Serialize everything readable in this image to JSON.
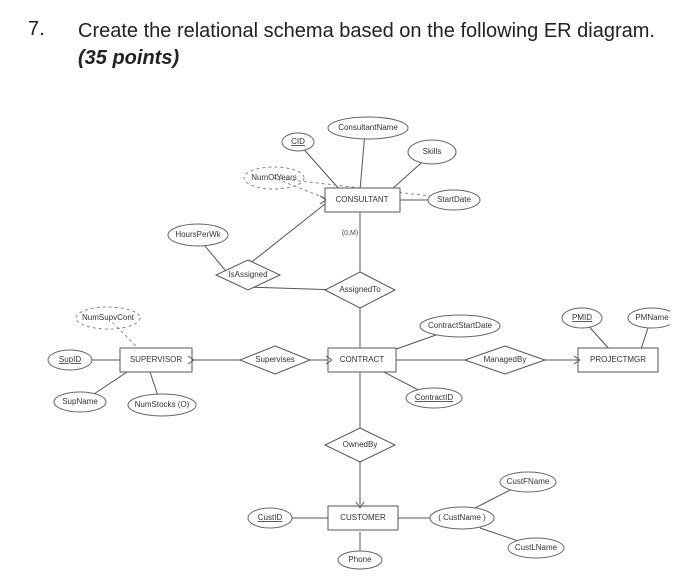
{
  "question": {
    "number": "7.",
    "text_before": "Create the relational schema based on the following ER diagram.",
    "points": "(35 points)"
  },
  "er": {
    "entities": {
      "consultant": "CONSULTANT",
      "supervisor": "SUPERVISOR",
      "contract": "CONTRACT",
      "projectmgr": "PROJECTMGR",
      "customer": "CUSTOMER"
    },
    "relationships": {
      "isAssigned": "IsAssigned",
      "assignedTo": "AssignedTo",
      "supervises": "Supervises",
      "managedBy": "ManagedBy",
      "ownedBy": "OwnedBy"
    },
    "attributes": {
      "cid": "CID",
      "consultantName": "ConsultantName",
      "skills": "Skills",
      "numOfYears": "NumOfYears",
      "startDate": "StartDate",
      "hoursPerWk": "HoursPerWk",
      "card_0M": "(0,M)",
      "supID": "SupID",
      "numSupvCont": "NumSupvCont",
      "supName": "SupName",
      "numStocks": "NumStocks (O)",
      "contractStartDate": "ContractStartDate",
      "contractID": "ContractID",
      "pmid": "PMID",
      "pmname": "PMName",
      "custID": "CustID",
      "custName": "( CustName )",
      "custFName": "CustFName",
      "custLName": "CustLName",
      "phone": "Phone"
    }
  }
}
